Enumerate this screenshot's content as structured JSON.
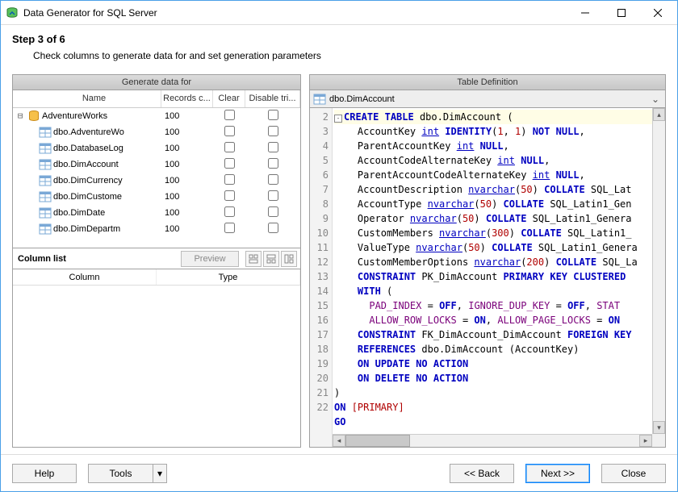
{
  "window": {
    "title": "Data Generator for SQL Server"
  },
  "step": {
    "label": "Step 3 of 6",
    "desc": "Check columns to generate data for and set generation parameters"
  },
  "panels": {
    "left_title": "Generate data for",
    "right_title": "Table Definition"
  },
  "tree": {
    "headers": {
      "name": "Name",
      "records": "Records c...",
      "clear": "Clear",
      "disable": "Disable tri..."
    },
    "root": {
      "label": "AdventureWorks",
      "records": "100"
    },
    "items": [
      {
        "label": "dbo.AdventureWo",
        "records": "100"
      },
      {
        "label": "dbo.DatabaseLog",
        "records": "100"
      },
      {
        "label": "dbo.DimAccount",
        "records": "100"
      },
      {
        "label": "dbo.DimCurrency",
        "records": "100"
      },
      {
        "label": "dbo.DimCustome",
        "records": "100"
      },
      {
        "label": "dbo.DimDate",
        "records": "100"
      },
      {
        "label": "dbo.DimDepartm",
        "records": "100"
      }
    ]
  },
  "column_list": {
    "title": "Column list",
    "preview": "Preview",
    "headers": {
      "column": "Column",
      "type": "Type"
    }
  },
  "definition": {
    "object": "dbo.DimAccount",
    "gutter": [
      "",
      "2",
      "3",
      "4",
      "5",
      "6",
      "7",
      "8",
      "9",
      "10",
      "11",
      "12",
      "13",
      "14",
      "15",
      "16",
      "17",
      "18",
      "19",
      "20",
      "21",
      "22"
    ]
  },
  "buttons": {
    "help": "Help",
    "tools": "Tools",
    "back": "<< Back",
    "next": "Next >>",
    "close": "Close"
  },
  "chart_data": {
    "type": "table",
    "create_table_sql": {
      "object": "dbo.DimAccount",
      "columns": [
        {
          "name": "AccountKey",
          "type": "int",
          "identity": [
            1,
            1
          ],
          "nullable": false
        },
        {
          "name": "ParentAccountKey",
          "type": "int",
          "nullable": true
        },
        {
          "name": "AccountCodeAlternateKey",
          "type": "int",
          "nullable": true
        },
        {
          "name": "ParentAccountCodeAlternateKey",
          "type": "int",
          "nullable": true
        },
        {
          "name": "AccountDescription",
          "type": "nvarchar(50)",
          "collate": "SQL_Lat…"
        },
        {
          "name": "AccountType",
          "type": "nvarchar(50)",
          "collate": "SQL_Latin1_Gen…"
        },
        {
          "name": "Operator",
          "type": "nvarchar(50)",
          "collate": "SQL_Latin1_Genera…"
        },
        {
          "name": "CustomMembers",
          "type": "nvarchar(300)",
          "collate": "SQL_Latin1_…"
        },
        {
          "name": "ValueType",
          "type": "nvarchar(50)",
          "collate": "SQL_Latin1_Genera…"
        },
        {
          "name": "CustomMemberOptions",
          "type": "nvarchar(200)",
          "collate": "SQL_La…"
        }
      ],
      "primary_key": {
        "name": "PK_DimAccount",
        "clustered": true,
        "with": {
          "PAD_INDEX": "OFF",
          "IGNORE_DUP_KEY": "OFF",
          "STAT…": null,
          "ALLOW_ROW_LOCKS": "ON",
          "ALLOW_PAGE_LOCKS": "ON"
        }
      },
      "foreign_keys": [
        {
          "name": "FK_DimAccount_DimAccount",
          "references": "dbo.DimAccount (AccountKey)",
          "on_update": "NO ACTION",
          "on_delete": "NO ACTION"
        }
      ],
      "on": "[PRIMARY]",
      "terminator": "GO"
    }
  }
}
